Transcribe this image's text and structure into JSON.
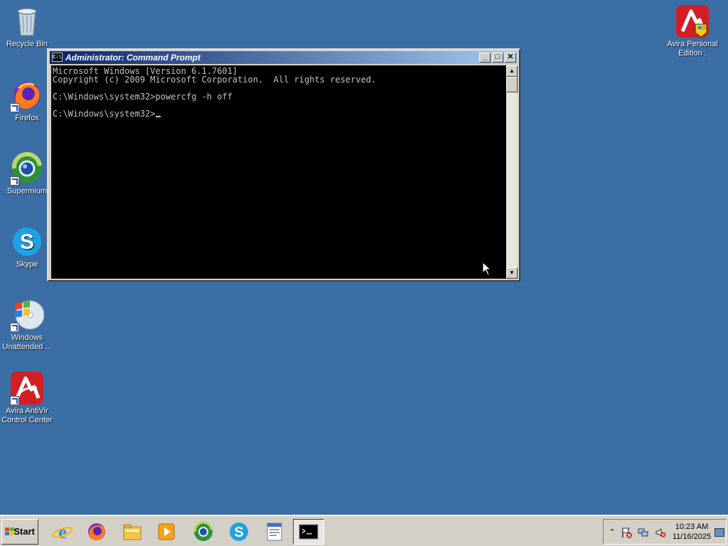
{
  "desktop": {
    "icons": [
      {
        "label": "Recycle Bin"
      },
      {
        "label": "Firefox"
      },
      {
        "label": "Supermium"
      },
      {
        "label": "Skype"
      },
      {
        "label": "Windows Unattended ..."
      },
      {
        "label": "Avira AntiVir Control Center"
      },
      {
        "label": "Avira Personal Edition ."
      }
    ]
  },
  "window": {
    "title": "Administrator: Command Prompt",
    "sys_icon_text": "C:\\",
    "console_lines": [
      "Microsoft Windows [Version 6.1.7601]",
      "Copyright (c) 2009 Microsoft Corporation.  All rights reserved.",
      "",
      "C:\\Windows\\system32>powercfg -h off",
      "",
      "C:\\Windows\\system32>"
    ],
    "buttons": {
      "minimize": "_",
      "maximize": "□",
      "close": "✕"
    }
  },
  "taskbar": {
    "start_label": "Start",
    "apps": [
      {
        "icon": "internet-explorer-icon"
      },
      {
        "icon": "firefox-icon"
      },
      {
        "icon": "file-explorer-icon"
      },
      {
        "icon": "media-player-icon"
      },
      {
        "icon": "supermium-icon"
      },
      {
        "icon": "skype-icon"
      },
      {
        "icon": "wordpad-icon"
      },
      {
        "icon": "command-prompt-icon",
        "active": true
      }
    ],
    "tray": {
      "icons": [
        "show-hidden-icons-chevron",
        "action-center-flag-icon",
        "network-icon",
        "volume-muted-icon"
      ],
      "time": "10:23 AM",
      "date": "11/16/2025"
    }
  },
  "colors": {
    "desktop_bg": "#3a6ea5",
    "titlebar_start": "#0a246a",
    "titlebar_end": "#a6caf0",
    "console_bg": "#000000",
    "console_text": "#c0c0c0"
  }
}
